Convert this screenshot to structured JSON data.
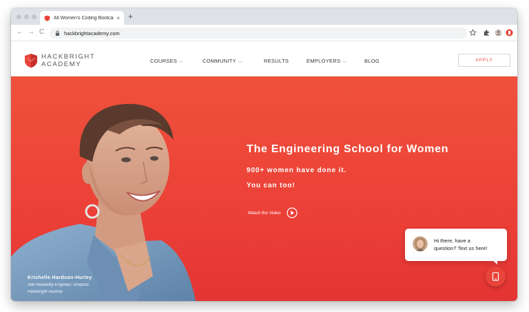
{
  "browser": {
    "tab_title": "All Women's Coding Bootcamp",
    "tab_close": "×",
    "new_tab": "+",
    "url": "hackbrightacademy.com",
    "nav": {
      "back": "←",
      "forward": "→",
      "reload": "C"
    }
  },
  "site": {
    "brand_line1": "HACKBRIGHT",
    "brand_line2": "ACADEMY",
    "nav_items": [
      {
        "label": "COURSES",
        "has_menu": true,
        "caret": "⌵"
      },
      {
        "label": "COMMUNITY",
        "has_menu": true,
        "caret": "⌵"
      },
      {
        "label": "RESULTS",
        "has_menu": false
      },
      {
        "label": "EMPLOYERS",
        "has_menu": true,
        "caret": "⌵"
      },
      {
        "label": "BLOG",
        "has_menu": false
      }
    ],
    "apply_label": "APPLY"
  },
  "hero": {
    "title": "The Engineering School for Women",
    "subtitle_line1": "900+ women have done it.",
    "subtitle_line2": "You can too!",
    "watch_label": "Watch the Video",
    "caption": {
      "name": "Krishelle Hardson-Hurley",
      "role": "Site Reliability Engineer, Dropbox",
      "note": "Hackbright Alumna"
    }
  },
  "chat": {
    "line1": "Hi there, have a",
    "line2": "question? Text us here!"
  },
  "colors": {
    "brand_red": "#e8443a",
    "hero_top": "#ef513b",
    "hero_bottom": "#e43433"
  },
  "icons": [
    "shield-logo-icon",
    "lock-icon",
    "star-icon",
    "extensions-icon",
    "play-icon",
    "phone-icon"
  ]
}
